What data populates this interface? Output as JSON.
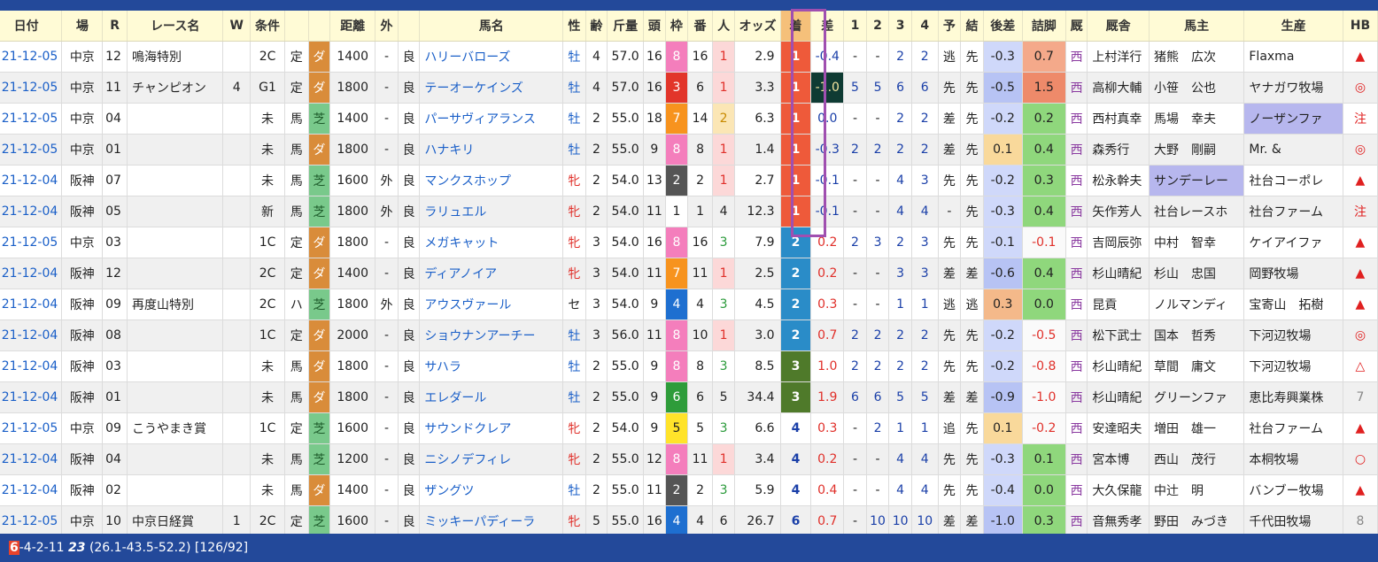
{
  "headers": [
    "日付",
    "場",
    "R",
    "レース名",
    "W",
    "条件",
    "",
    "",
    "距離",
    "外",
    "",
    "馬名",
    "性",
    "齢",
    "斤量",
    "頭",
    "枠",
    "番",
    "人",
    "オッズ",
    "着",
    "差",
    "1",
    "2",
    "3",
    "4",
    "予",
    "結",
    "後差",
    "詰脚",
    "厩",
    "厩舎",
    "馬主",
    "生産",
    "HB"
  ],
  "colors": {
    "header_bg": "#fffbd6",
    "top_bar": "#23499a",
    "highlight_border": "#a04fb0",
    "dirt": "#d98c3a",
    "turf": "#79c98b",
    "west": "#8a3aa0"
  },
  "rows": [
    {
      "date": "21-12-05",
      "place": "中京",
      "r": "12",
      "race": "鳴海特別",
      "w": "",
      "cond1": "2C",
      "cond2": "定",
      "surf": "ダ",
      "dist": "1400",
      "out": "-",
      "track": "良",
      "horse": "ハリーバローズ",
      "sex": "牡",
      "age": "4",
      "weight": "57.0",
      "heads": "16",
      "waku": "8",
      "ban": "16",
      "pop": "1",
      "odds": "2.9",
      "pos": "1",
      "diff": "-0.4",
      "c1": "-",
      "c2": "-",
      "c3": "2",
      "c4": "2",
      "yo": "逃",
      "ke": "先",
      "gosa": "-0.3",
      "tsume": "0.7",
      "west": "西",
      "trainer": "上村洋行",
      "owner": "猪熊　広次",
      "breeder": "Flaxma",
      "hb": "▲"
    },
    {
      "date": "21-12-05",
      "place": "中京",
      "r": "11",
      "race": "チャンピオン",
      "w": "4",
      "cond1": "G1",
      "cond2": "定",
      "surf": "ダ",
      "dist": "1800",
      "out": "-",
      "track": "良",
      "horse": "テーオーケインズ",
      "sex": "牡",
      "age": "4",
      "weight": "57.0",
      "heads": "16",
      "waku": "3",
      "ban": "6",
      "pop": "1",
      "odds": "3.3",
      "pos": "1",
      "diff": "-1.0",
      "c1": "5",
      "c2": "5",
      "c3": "6",
      "c4": "6",
      "yo": "先",
      "ke": "先",
      "gosa": "-0.5",
      "tsume": "1.5",
      "west": "西",
      "trainer": "高柳大輔",
      "owner": "小笹　公也",
      "breeder": "ヤナガワ牧場",
      "hb": "◎"
    },
    {
      "date": "21-12-05",
      "place": "中京",
      "r": "04",
      "race": "",
      "w": "",
      "cond1": "未",
      "cond2": "馬",
      "surf": "芝",
      "dist": "1400",
      "out": "-",
      "track": "良",
      "horse": "パーサヴィアランス",
      "sex": "牡",
      "age": "2",
      "weight": "55.0",
      "heads": "18",
      "waku": "7",
      "ban": "14",
      "pop": "2",
      "odds": "6.3",
      "pos": "1",
      "diff": "0.0",
      "c1": "-",
      "c2": "-",
      "c3": "2",
      "c4": "2",
      "yo": "差",
      "ke": "先",
      "gosa": "-0.2",
      "tsume": "0.2",
      "west": "西",
      "trainer": "西村真幸",
      "owner": "馬場　幸夫",
      "breeder": "ノーザンファ",
      "hb": "注"
    },
    {
      "date": "21-12-05",
      "place": "中京",
      "r": "01",
      "race": "",
      "w": "",
      "cond1": "未",
      "cond2": "馬",
      "surf": "ダ",
      "dist": "1800",
      "out": "-",
      "track": "良",
      "horse": "ハナキリ",
      "sex": "牡",
      "age": "2",
      "weight": "55.0",
      "heads": "9",
      "waku": "8",
      "ban": "8",
      "pop": "1",
      "odds": "1.4",
      "pos": "1",
      "diff": "-0.3",
      "c1": "2",
      "c2": "2",
      "c3": "2",
      "c4": "2",
      "yo": "差",
      "ke": "先",
      "gosa": "0.1",
      "tsume": "0.4",
      "west": "西",
      "trainer": "森秀行",
      "owner": "大野　剛嗣",
      "breeder": "Mr. &",
      "hb": "◎"
    },
    {
      "date": "21-12-04",
      "place": "阪神",
      "r": "07",
      "race": "",
      "w": "",
      "cond1": "未",
      "cond2": "馬",
      "surf": "芝",
      "dist": "1600",
      "out": "外",
      "track": "良",
      "horse": "マンクスホップ",
      "sex": "牝",
      "age": "2",
      "weight": "54.0",
      "heads": "13",
      "waku": "2",
      "ban": "2",
      "pop": "1",
      "odds": "2.7",
      "pos": "1",
      "diff": "-0.1",
      "c1": "-",
      "c2": "-",
      "c3": "4",
      "c4": "3",
      "yo": "先",
      "ke": "先",
      "gosa": "-0.2",
      "tsume": "0.3",
      "west": "西",
      "trainer": "松永幹夫",
      "owner": "サンデーレー",
      "breeder": "社台コーポレ",
      "hb": "▲"
    },
    {
      "date": "21-12-04",
      "place": "阪神",
      "r": "05",
      "race": "",
      "w": "",
      "cond1": "新",
      "cond2": "馬",
      "surf": "芝",
      "dist": "1800",
      "out": "外",
      "track": "良",
      "horse": "ラリュエル",
      "sex": "牝",
      "age": "2",
      "weight": "54.0",
      "heads": "11",
      "waku": "1",
      "ban": "1",
      "pop": "4",
      "odds": "12.3",
      "pos": "1",
      "diff": "-0.1",
      "c1": "-",
      "c2": "-",
      "c3": "4",
      "c4": "4",
      "yo": "-",
      "ke": "先",
      "gosa": "-0.3",
      "tsume": "0.4",
      "west": "西",
      "trainer": "矢作芳人",
      "owner": "社台レースホ",
      "breeder": "社台ファーム",
      "hb": "注"
    },
    {
      "date": "21-12-05",
      "place": "中京",
      "r": "03",
      "race": "",
      "w": "",
      "cond1": "1C",
      "cond2": "定",
      "surf": "ダ",
      "dist": "1800",
      "out": "-",
      "track": "良",
      "horse": "メガキャット",
      "sex": "牝",
      "age": "3",
      "weight": "54.0",
      "heads": "16",
      "waku": "8",
      "ban": "16",
      "pop": "3",
      "odds": "7.9",
      "pos": "2",
      "diff": "0.2",
      "c1": "2",
      "c2": "3",
      "c3": "2",
      "c4": "3",
      "yo": "先",
      "ke": "先",
      "gosa": "-0.1",
      "tsume": "-0.1",
      "west": "西",
      "trainer": "吉岡辰弥",
      "owner": "中村　智幸",
      "breeder": "ケイアイファ",
      "hb": "▲"
    },
    {
      "date": "21-12-04",
      "place": "阪神",
      "r": "12",
      "race": "",
      "w": "",
      "cond1": "2C",
      "cond2": "定",
      "surf": "ダ",
      "dist": "1400",
      "out": "-",
      "track": "良",
      "horse": "ディアノイア",
      "sex": "牝",
      "age": "3",
      "weight": "54.0",
      "heads": "11",
      "waku": "7",
      "ban": "11",
      "pop": "1",
      "odds": "2.5",
      "pos": "2",
      "diff": "0.2",
      "c1": "-",
      "c2": "-",
      "c3": "3",
      "c4": "3",
      "yo": "差",
      "ke": "差",
      "gosa": "-0.6",
      "tsume": "0.4",
      "west": "西",
      "trainer": "杉山晴紀",
      "owner": "杉山　忠国",
      "breeder": "岡野牧場",
      "hb": "▲"
    },
    {
      "date": "21-12-04",
      "place": "阪神",
      "r": "09",
      "race": "再度山特別",
      "w": "",
      "cond1": "2C",
      "cond2": "ハ",
      "surf": "芝",
      "dist": "1800",
      "out": "外",
      "track": "良",
      "horse": "アウスヴァール",
      "sex": "セ",
      "age": "3",
      "weight": "54.0",
      "heads": "9",
      "waku": "4",
      "ban": "4",
      "pop": "3",
      "odds": "4.5",
      "pos": "2",
      "diff": "0.3",
      "c1": "-",
      "c2": "-",
      "c3": "1",
      "c4": "1",
      "yo": "逃",
      "ke": "逃",
      "gosa": "0.3",
      "tsume": "0.0",
      "west": "西",
      "trainer": "昆貢",
      "owner": "ノルマンディ",
      "breeder": "宝寄山　拓樹",
      "hb": "▲"
    },
    {
      "date": "21-12-04",
      "place": "阪神",
      "r": "08",
      "race": "",
      "w": "",
      "cond1": "1C",
      "cond2": "定",
      "surf": "ダ",
      "dist": "2000",
      "out": "-",
      "track": "良",
      "horse": "ショウナンアーチー",
      "sex": "牡",
      "age": "3",
      "weight": "56.0",
      "heads": "11",
      "waku": "8",
      "ban": "10",
      "pop": "1",
      "odds": "3.0",
      "pos": "2",
      "diff": "0.7",
      "c1": "2",
      "c2": "2",
      "c3": "2",
      "c4": "2",
      "yo": "先",
      "ke": "先",
      "gosa": "-0.2",
      "tsume": "-0.5",
      "west": "西",
      "trainer": "松下武士",
      "owner": "国本　哲秀",
      "breeder": "下河辺牧場",
      "hb": "◎"
    },
    {
      "date": "21-12-04",
      "place": "阪神",
      "r": "03",
      "race": "",
      "w": "",
      "cond1": "未",
      "cond2": "馬",
      "surf": "ダ",
      "dist": "1800",
      "out": "-",
      "track": "良",
      "horse": "サハラ",
      "sex": "牡",
      "age": "2",
      "weight": "55.0",
      "heads": "9",
      "waku": "8",
      "ban": "8",
      "pop": "3",
      "odds": "8.5",
      "pos": "3",
      "diff": "1.0",
      "c1": "2",
      "c2": "2",
      "c3": "2",
      "c4": "2",
      "yo": "先",
      "ke": "先",
      "gosa": "-0.2",
      "tsume": "-0.8",
      "west": "西",
      "trainer": "杉山晴紀",
      "owner": "草間　庸文",
      "breeder": "下河辺牧場",
      "hb": "△"
    },
    {
      "date": "21-12-04",
      "place": "阪神",
      "r": "01",
      "race": "",
      "w": "",
      "cond1": "未",
      "cond2": "馬",
      "surf": "ダ",
      "dist": "1800",
      "out": "-",
      "track": "良",
      "horse": "エレダール",
      "sex": "牡",
      "age": "2",
      "weight": "55.0",
      "heads": "9",
      "waku": "6",
      "ban": "6",
      "pop": "5",
      "odds": "34.4",
      "pos": "3",
      "diff": "1.9",
      "c1": "6",
      "c2": "6",
      "c3": "5",
      "c4": "5",
      "yo": "差",
      "ke": "差",
      "gosa": "-0.9",
      "tsume": "-1.0",
      "west": "西",
      "trainer": "杉山晴紀",
      "owner": "グリーンファ",
      "breeder": "恵比寿興業株",
      "hb": "7"
    },
    {
      "date": "21-12-05",
      "place": "中京",
      "r": "09",
      "race": "こうやまき賞",
      "w": "",
      "cond1": "1C",
      "cond2": "定",
      "surf": "芝",
      "dist": "1600",
      "out": "-",
      "track": "良",
      "horse": "サウンドクレア",
      "sex": "牝",
      "age": "2",
      "weight": "54.0",
      "heads": "9",
      "waku": "5",
      "ban": "5",
      "pop": "3",
      "odds": "6.6",
      "pos": "4",
      "diff": "0.3",
      "c1": "-",
      "c2": "2",
      "c3": "1",
      "c4": "1",
      "yo": "追",
      "ke": "先",
      "gosa": "0.1",
      "tsume": "-0.2",
      "west": "西",
      "trainer": "安達昭夫",
      "owner": "増田　雄一",
      "breeder": "社台ファーム",
      "hb": "▲"
    },
    {
      "date": "21-12-04",
      "place": "阪神",
      "r": "04",
      "race": "",
      "w": "",
      "cond1": "未",
      "cond2": "馬",
      "surf": "芝",
      "dist": "1200",
      "out": "-",
      "track": "良",
      "horse": "ニシノデフィレ",
      "sex": "牝",
      "age": "2",
      "weight": "55.0",
      "heads": "12",
      "waku": "8",
      "ban": "11",
      "pop": "1",
      "odds": "3.4",
      "pos": "4",
      "diff": "0.2",
      "c1": "-",
      "c2": "-",
      "c3": "4",
      "c4": "4",
      "yo": "先",
      "ke": "先",
      "gosa": "-0.3",
      "tsume": "0.1",
      "west": "西",
      "trainer": "宮本博",
      "owner": "西山　茂行",
      "breeder": "本桐牧場",
      "hb": "○"
    },
    {
      "date": "21-12-04",
      "place": "阪神",
      "r": "02",
      "race": "",
      "w": "",
      "cond1": "未",
      "cond2": "馬",
      "surf": "ダ",
      "dist": "1400",
      "out": "-",
      "track": "良",
      "horse": "ザングツ",
      "sex": "牡",
      "age": "2",
      "weight": "55.0",
      "heads": "11",
      "waku": "2",
      "ban": "2",
      "pop": "3",
      "odds": "5.9",
      "pos": "4",
      "diff": "0.4",
      "c1": "-",
      "c2": "-",
      "c3": "4",
      "c4": "4",
      "yo": "先",
      "ke": "先",
      "gosa": "-0.4",
      "tsume": "0.0",
      "west": "西",
      "trainer": "大久保龍",
      "owner": "中辻　明",
      "breeder": "バンブー牧場",
      "hb": "▲"
    },
    {
      "date": "21-12-05",
      "place": "中京",
      "r": "10",
      "race": "中京日経賞",
      "w": "1",
      "cond1": "2C",
      "cond2": "定",
      "surf": "芝",
      "dist": "1600",
      "out": "-",
      "track": "良",
      "horse": "ミッキーパディーラ",
      "sex": "牝",
      "age": "5",
      "weight": "55.0",
      "heads": "16",
      "waku": "4",
      "ban": "4",
      "pop": "6",
      "odds": "26.7",
      "pos": "6",
      "diff": "0.7",
      "c1": "-",
      "c2": "10",
      "c3": "10",
      "c4": "10",
      "yo": "差",
      "ke": "差",
      "gosa": "-1.0",
      "tsume": "0.3",
      "west": "西",
      "trainer": "音無秀孝",
      "owner": "野田　みづき",
      "breeder": "千代田牧場",
      "hb": "8"
    }
  ],
  "footer": {
    "highlight": "6",
    "record": "-4-2-11",
    "bold": "23",
    "detail": "(26.1-43.5-52.2) [126/92]"
  }
}
